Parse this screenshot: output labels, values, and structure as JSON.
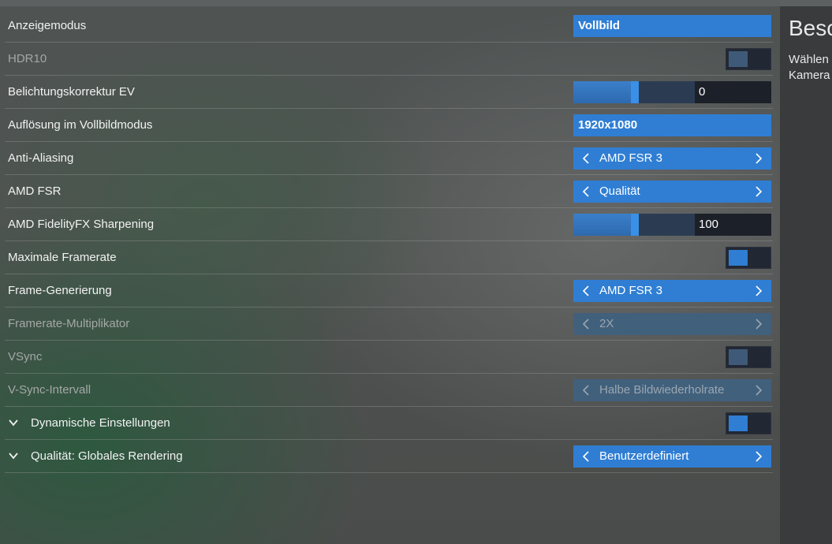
{
  "settings": [
    {
      "label": "Anzeigemodus",
      "type": "box",
      "value": "Vollbild"
    },
    {
      "label": "HDR10",
      "type": "toggle",
      "state": "off",
      "disabled": true
    },
    {
      "label": "Belichtungskorrektur EV",
      "type": "slider",
      "value": "0",
      "fraction": 0.5
    },
    {
      "label": "Auflösung im Vollbildmodus",
      "type": "box",
      "value": "1920x1080"
    },
    {
      "label": "Anti-Aliasing",
      "type": "selector",
      "value": "AMD FSR 3"
    },
    {
      "label": "AMD FSR",
      "type": "selector",
      "value": "Qualität"
    },
    {
      "label": "AMD FidelityFX Sharpening",
      "type": "slider",
      "value": "100",
      "fraction": 0.5
    },
    {
      "label": "Maximale Framerate",
      "type": "toggle",
      "state": "on"
    },
    {
      "label": "Frame-Generierung",
      "type": "selector",
      "value": "AMD FSR 3"
    },
    {
      "label": "Framerate-Multiplikator",
      "type": "selector",
      "value": "2X",
      "disabled": true
    },
    {
      "label": "VSync",
      "type": "toggle",
      "state": "off",
      "disabled": true
    },
    {
      "label": "V-Sync-Intervall",
      "type": "selector",
      "value": "Halbe Bildwiederholrate",
      "disabled": true
    },
    {
      "label": "Dynamische Einstellungen",
      "type": "toggle",
      "state": "on",
      "expandable": true
    },
    {
      "label": "Qualität: Globales Rendering",
      "type": "selector",
      "value": "Benutzerdefiniert",
      "expandable": true
    }
  ],
  "description_panel": {
    "title": "Besc",
    "text_line1": "Wählen",
    "text_line2": "Kamera"
  },
  "colors": {
    "accent": "#2f7ed4",
    "accent_disabled": "#41607c",
    "toggle_track": "#222833"
  },
  "icons": {
    "expand": "chevron-down-icon",
    "prev": "chevron-left-icon",
    "next": "chevron-right-icon"
  }
}
